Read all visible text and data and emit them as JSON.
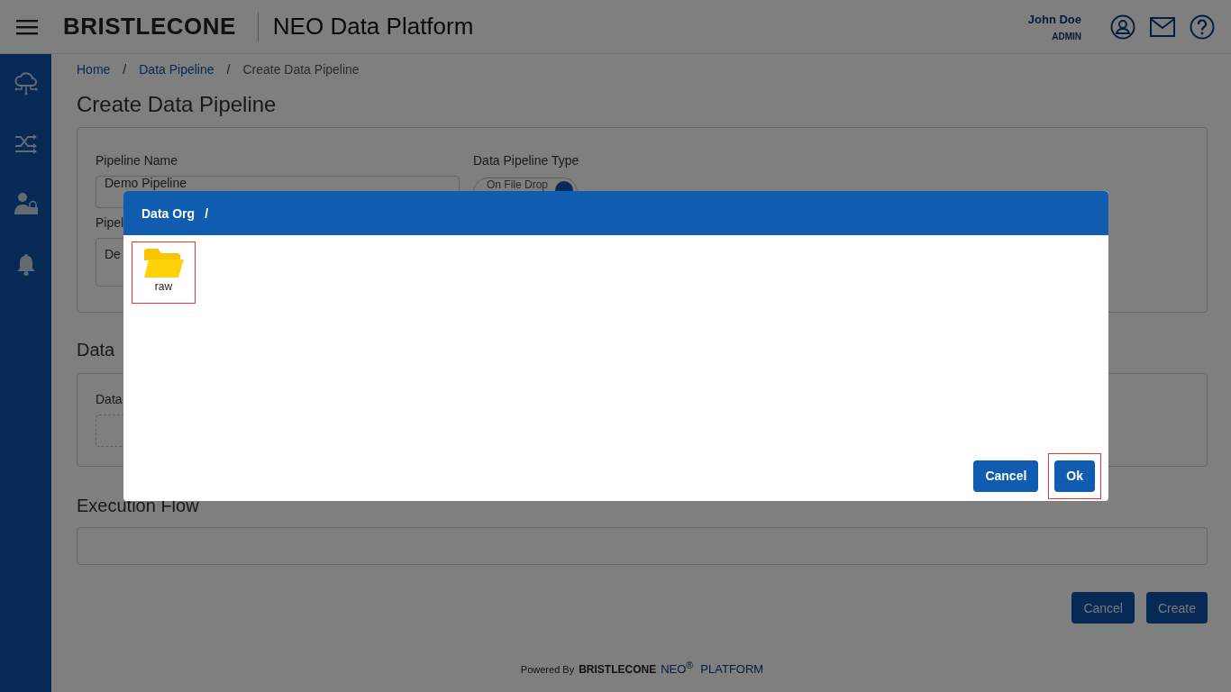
{
  "header": {
    "logo": "BRISTLECONE",
    "app_title": "NEO Data Platform",
    "user_name": "John Doe",
    "user_role": "ADMIN"
  },
  "breadcrumb": [
    {
      "label": "Home",
      "current": false
    },
    {
      "label": "Data Pipeline",
      "current": false
    },
    {
      "label": "Create Data Pipeline",
      "current": true
    }
  ],
  "breadcrumb_separators": [
    "/",
    "/"
  ],
  "page_title": "Create Data Pipeline",
  "details": {
    "name_label": "Pipeline Name",
    "name_value": "Demo Pipeline",
    "type_label": "Data Pipeline Type",
    "type_toggle": {
      "label": "On File Drop",
      "on": true
    },
    "desc_label": "Pipel",
    "desc_value": "De"
  },
  "source_section": {
    "title": "Data",
    "field_label": "Data"
  },
  "execution_section": {
    "title": "Execution Flow"
  },
  "page_buttons": [
    "Cancel",
    "Create"
  ],
  "footer": {
    "prefix": "Powered By",
    "logo": "BRISTLECONE",
    "product": "NEO$^{®}$",
    "suffix": "PLATFORM"
  },
  "dialog": {
    "path": [
      "Data Org",
      "/"
    ],
    "folders": [
      {
        "name": "raw",
        "selected": true
      }
    ],
    "buttons": [
      {
        "label": "Cancel",
        "highlighted": false
      },
      {
        "label": "Ok",
        "highlighted": true
      }
    ]
  }
}
